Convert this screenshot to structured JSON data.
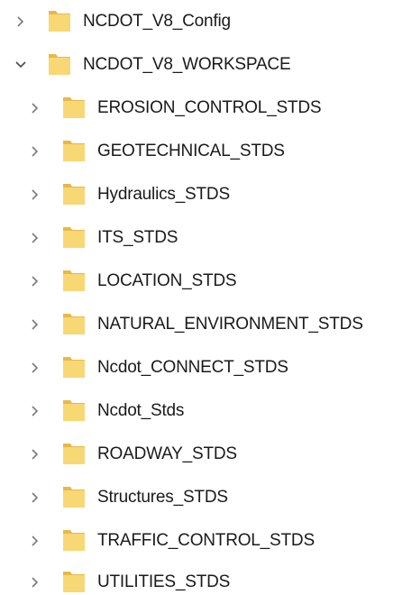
{
  "tree": {
    "root_items": [
      {
        "label": "NCDOT_V8_Config",
        "expanded": false,
        "icon": "folder-icon"
      },
      {
        "label": "NCDOT_V8_WORKSPACE",
        "expanded": true,
        "icon": "folder-icon"
      }
    ],
    "workspace_children": [
      {
        "label": "EROSION_CONTROL_STDS",
        "expanded": false,
        "icon": "folder-icon"
      },
      {
        "label": "GEOTECHNICAL_STDS",
        "expanded": false,
        "icon": "folder-icon"
      },
      {
        "label": "Hydraulics_STDS",
        "expanded": false,
        "icon": "folder-icon"
      },
      {
        "label": "ITS_STDS",
        "expanded": false,
        "icon": "folder-icon"
      },
      {
        "label": "LOCATION_STDS",
        "expanded": false,
        "icon": "folder-icon"
      },
      {
        "label": "NATURAL_ENVIRONMENT_STDS",
        "expanded": false,
        "icon": "folder-icon"
      },
      {
        "label": "Ncdot_CONNECT_STDS",
        "expanded": false,
        "icon": "folder-icon"
      },
      {
        "label": "Ncdot_Stds",
        "expanded": false,
        "icon": "folder-icon"
      },
      {
        "label": "ROADWAY_STDS",
        "expanded": false,
        "icon": "folder-icon"
      },
      {
        "label": "Structures_STDS",
        "expanded": false,
        "icon": "folder-icon"
      },
      {
        "label": "TRAFFIC_CONTROL_STDS",
        "expanded": false,
        "icon": "folder-icon"
      },
      {
        "label": "UTILITIES_STDS",
        "expanded": false,
        "icon": "folder-icon"
      }
    ]
  },
  "colors": {
    "folder_body": "#f8d775",
    "folder_back": "#e8b84a",
    "chevron": "#7a7a7a",
    "text": "#1a1a1a"
  }
}
